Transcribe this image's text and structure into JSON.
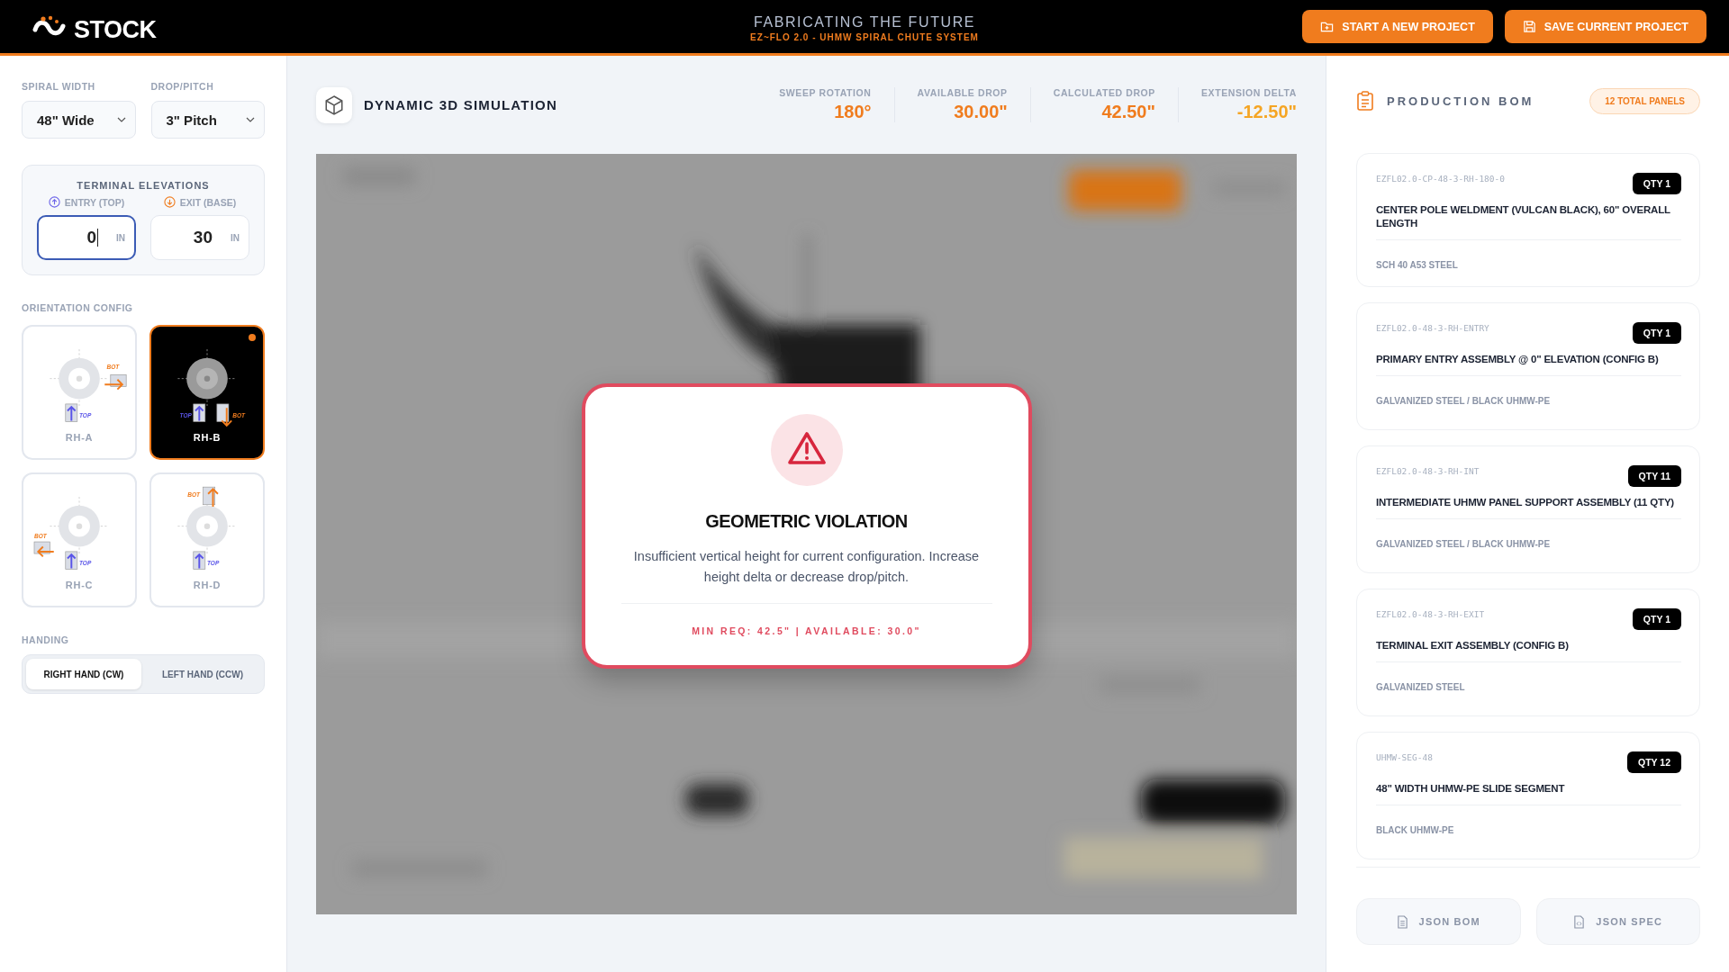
{
  "header": {
    "logo": "STOCK",
    "title": "FABRICATING THE FUTURE",
    "subtitle": "EZ~FLO 2.0 - UHMW SPIRAL CHUTE SYSTEM",
    "buttons": [
      {
        "label": "START A NEW PROJECT",
        "kind": "new"
      },
      {
        "label": "SAVE CURRENT PROJECT",
        "kind": "save"
      }
    ]
  },
  "sidebar": {
    "selects": [
      {
        "label": "SPIRAL WIDTH",
        "value": "48\" Wide"
      },
      {
        "label": "DROP/PITCH",
        "value": "3\" Pitch"
      }
    ],
    "elevations": {
      "title": "TERMINAL ELEVATIONS",
      "fields": [
        {
          "label": "ENTRY (TOP)",
          "kind": "entry",
          "value": "0",
          "unit": "IN",
          "focused": true
        },
        {
          "label": "EXIT (BASE)",
          "kind": "exit",
          "value": "30",
          "unit": "IN",
          "focused": false
        }
      ]
    },
    "orientation": {
      "title": "ORIENTATION CONFIG",
      "options": [
        {
          "label": "RH-A",
          "kind": "right",
          "entry_tag": "TOP",
          "exit_tag": "BOT",
          "selected": false
        },
        {
          "label": "RH-B",
          "kind": "down",
          "entry_tag": "TOP",
          "exit_tag": "BOT",
          "selected": true
        },
        {
          "label": "RH-C",
          "kind": "left",
          "entry_tag": "TOP",
          "exit_tag": "BOT",
          "selected": false
        },
        {
          "label": "RH-D",
          "kind": "up",
          "entry_tag": "TOP",
          "exit_tag": "BOT",
          "selected": false
        }
      ]
    },
    "handing": {
      "title": "HANDING",
      "options": [
        {
          "label": "RIGHT HAND (CW)",
          "selected": true
        },
        {
          "label": "LEFT HAND (CCW)",
          "selected": false
        }
      ]
    }
  },
  "simulation": {
    "title": "DYNAMIC 3D SIMULATION",
    "metrics": [
      {
        "label": "SWEEP ROTATION",
        "value": "180°",
        "color": "#f07c1e"
      },
      {
        "label": "AVAILABLE DROP",
        "value": "30.00\"",
        "color": "#f07c1e"
      },
      {
        "label": "CALCULATED DROP",
        "value": "42.50\"",
        "color": "#f07c1e"
      },
      {
        "label": "EXTENSION DELTA",
        "value": "-12.50\"",
        "color": "#f5a524"
      }
    ],
    "alert": {
      "title": "GEOMETRIC VIOLATION",
      "message": "Insufficient vertical height for current configuration. Increase height delta or decrease drop/pitch.",
      "detail": "MIN REQ: 42.5\" | AVAILABLE: 30.0\""
    }
  },
  "bom": {
    "title": "PRODUCTION BOM",
    "badge": "12 TOTAL PANELS",
    "items": [
      {
        "code": "EZFL02.0-CP-48-3-RH-180-0",
        "qty": "QTY 1",
        "name": "CENTER POLE WELDMENT (VULCAN BLACK), 60\" OVERALL LENGTH",
        "material": "SCH 40 A53 STEEL"
      },
      {
        "code": "EZFL02.0-48-3-RH-ENTRY",
        "qty": "QTY 1",
        "name": "PRIMARY ENTRY ASSEMBLY @ 0\" ELEVATION (CONFIG B)",
        "material": "GALVANIZED STEEL / BLACK UHMW-PE"
      },
      {
        "code": "EZFL02.0-48-3-RH-INT",
        "qty": "QTY 11",
        "name": "INTERMEDIATE UHMW PANEL SUPPORT ASSEMBLY (11 QTY)",
        "material": "GALVANIZED STEEL / BLACK UHMW-PE"
      },
      {
        "code": "EZFL02.0-48-3-RH-EXIT",
        "qty": "QTY 1",
        "name": "TERMINAL EXIT ASSEMBLY (CONFIG B)",
        "material": "GALVANIZED STEEL"
      },
      {
        "code": "UHMW-SEG-48",
        "qty": "QTY 12",
        "name": "48\" WIDTH UHMW-PE SLIDE SEGMENT",
        "material": "BLACK UHMW-PE"
      }
    ],
    "exports": [
      {
        "label": "JSON BOM",
        "kind": "list"
      },
      {
        "label": "JSON SPEC",
        "kind": "code"
      }
    ]
  }
}
